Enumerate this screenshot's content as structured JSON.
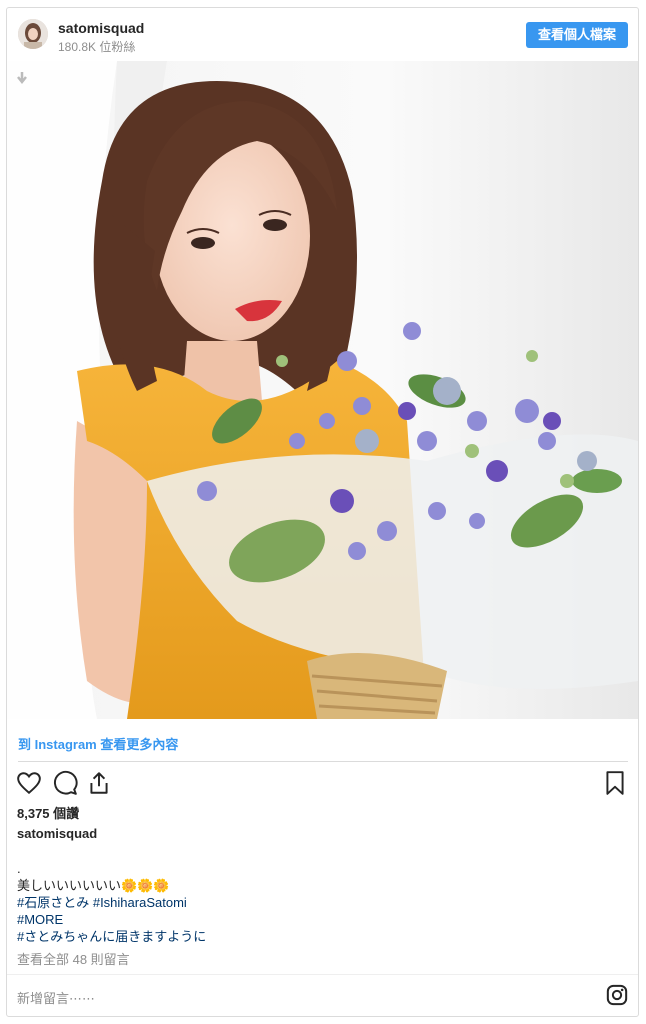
{
  "header": {
    "username": "satomisquad",
    "followers": "180.8K 位粉絲",
    "profile_button": "查看個人檔案"
  },
  "photo": {
    "description_icon": "download-arrow-icon"
  },
  "more_link": "到 Instagram 查看更多內容",
  "actions": {
    "like_icon": "heart-icon",
    "comment_icon": "comment-icon",
    "share_icon": "share-icon",
    "save_icon": "bookmark-icon"
  },
  "likes": "8,375 個讚",
  "caption": {
    "username": "satomisquad",
    "lines": [
      ".",
      "美しいいいいいい🌼🌼🌼",
      "#石原さとみ #IshiharaSatomi",
      "#MORE",
      "#さとみちゃんに届きますように"
    ]
  },
  "comments_link": "查看全部 48 則留言",
  "add_comment_placeholder": "新增留言⋯⋯",
  "colors": {
    "accent": "#3897f0",
    "text": "#262626",
    "muted": "#8e8e8e",
    "hashtag": "#003569"
  }
}
